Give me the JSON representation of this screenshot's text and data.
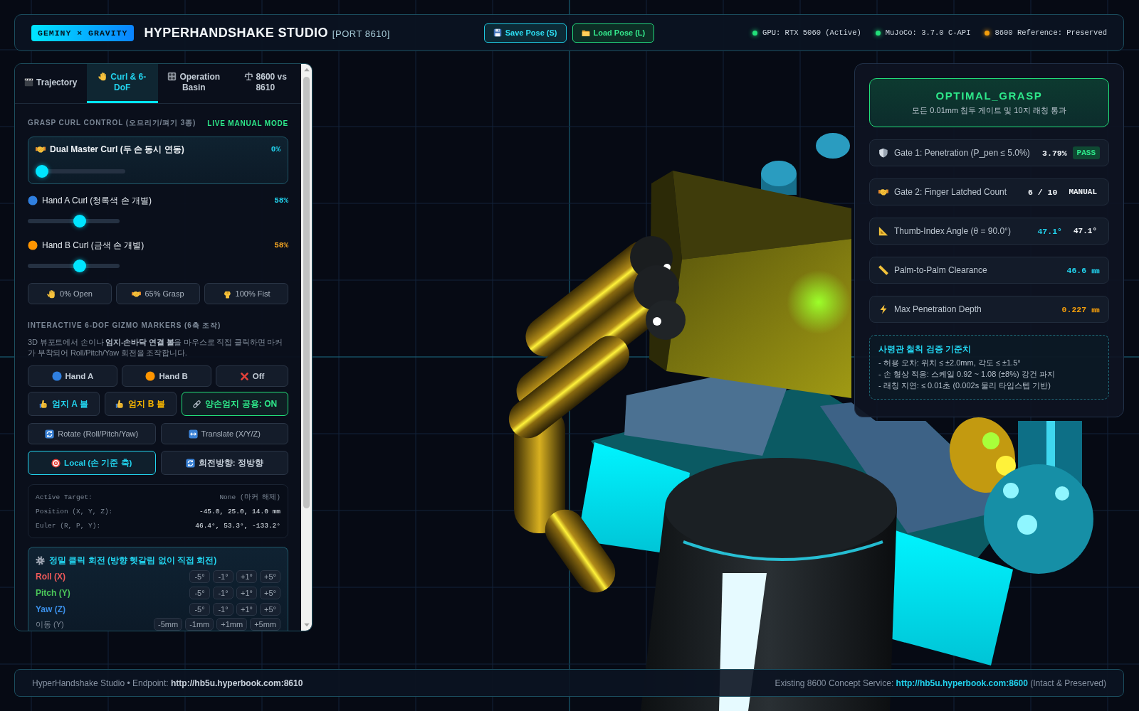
{
  "header": {
    "brand": "GEMINY × GRAVITY",
    "title": "HYPERHANDSHAKE STUDIO",
    "port": "[PORT 8610]",
    "buttons": [
      {
        "label": "Save Pose (S)",
        "kind": "save"
      },
      {
        "label": "Load Pose (L)",
        "kind": "load"
      }
    ],
    "status": [
      {
        "label": "GPU: RTX 5060 (Active)",
        "color": "#22e07a"
      },
      {
        "label": "MuJoCo: 3.7.0 C-API",
        "color": "#22e07a"
      },
      {
        "label": "8600 Reference: Preserved",
        "color": "#f59e0b"
      }
    ]
  },
  "left_panel": {
    "tabs": [
      {
        "label": "Trajectory",
        "selected": false
      },
      {
        "label": "Curl & 6-DoF",
        "selected": true
      },
      {
        "label": "Operation Basin",
        "selected": false
      },
      {
        "label": "8600 vs 8610",
        "selected": false
      }
    ],
    "curl": {
      "title": "GRASP CURL CONTROL (오므리기/펴기 3종)",
      "mode": "LIVE MANUAL MODE",
      "master": {
        "label": "Dual Master Curl (두 손 동시 연동)",
        "reading": "0%",
        "level": 0
      },
      "hands": [
        {
          "label": "Hand A Curl (청록색 손 개별)",
          "reading": "58%",
          "level": 0.58,
          "color": "#22d3ee"
        },
        {
          "label": "Hand B Curl (금색 손 개별)",
          "reading": "58%",
          "level": 0.58,
          "color": "#f5a623"
        }
      ],
      "presets": [
        "0% Open",
        "65% Grasp",
        "100% Fist"
      ]
    },
    "gizmo": {
      "title": "INTERACTIVE 6-DOF GIZMO MARKERS (6축 조작)",
      "description": "3D 뷰포트에서 손이나 **엄지-손바닥 연결 볼**을 마우스로 직접 클릭하면 마커가 부착되어 Roll/Pitch/Yaw 회전을 조작합니다.",
      "targets": [
        {
          "label": "Hand A",
          "selected": false
        },
        {
          "label": "Hand B",
          "selected": false
        },
        {
          "label": "Off",
          "selected": false
        }
      ],
      "thumb_balls": [
        {
          "label": "엄지 A 볼",
          "color": "#22d3ee"
        },
        {
          "label": "엄지 B 볼",
          "color": "#f5b400"
        }
      ],
      "shared_thumb": {
        "label": "양손엄지 공용: ON",
        "on": true
      },
      "modes": [
        {
          "label": "Rotate (Roll/Pitch/Yaw)",
          "selected": false
        },
        {
          "label": "Translate (X/Y/Z)",
          "selected": false
        }
      ],
      "options": [
        {
          "label": "Local (손 기준 축)",
          "on": true
        },
        {
          "label": "회전방향: 정방향",
          "on": false
        }
      ],
      "readout": [
        {
          "label": "Active Target:",
          "value": "None (마커 해제)",
          "muted": true
        },
        {
          "label": "Position (X, Y, Z):",
          "value": "-45.0, 25.0, 14.0 mm",
          "muted": false
        },
        {
          "label": "Euler (R, P, Y):",
          "value": "46.4°, 53.3°, -133.2°",
          "muted": false
        }
      ],
      "precision": {
        "title": "정밀 클릭 회전 (방향 헷갈림 없이 직접 회전)",
        "axes": [
          {
            "label": "Roll (X)",
            "color": "#f05a5a",
            "steps": [
              "-5°",
              "-1°",
              "+1°",
              "+5°"
            ]
          },
          {
            "label": "Pitch (Y)",
            "color": "#4cc85a",
            "steps": [
              "-5°",
              "-1°",
              "+1°",
              "+5°"
            ]
          },
          {
            "label": "Yaw (Z)",
            "color": "#3b8fe8",
            "steps": [
              "-5°",
              "-1°",
              "+1°",
              "+5°"
            ]
          }
        ],
        "translate": {
          "label": "이동 (Y)",
          "steps": [
            "-5mm",
            "-1mm",
            "+1mm",
            "+5mm"
          ]
        }
      }
    }
  },
  "right_panel": {
    "status": {
      "title": "OPTIMAL_GRASP",
      "subtitle": "모든 0.01mm 침투 게이트 및 10지 래칭 통과"
    },
    "metrics": [
      {
        "label": "Gate 1: Penetration (P_pen ≤ 5.0%)",
        "value": "3.79%",
        "color": "#f1f5f9",
        "badge": {
          "text": "PASS",
          "kind": "pass"
        }
      },
      {
        "label": "Gate 2: Finger Latched Count",
        "value": "6 / 10",
        "color": "#f1f5f9",
        "badge": {
          "text": "MANUAL",
          "kind": "plain"
        }
      },
      {
        "label": "Thumb-Index Angle (θ = 90.0°)",
        "value": "47.1°",
        "color": "#22d3ee",
        "badge": {
          "text": "47.1°",
          "kind": "plain"
        }
      },
      {
        "label": "Palm-to-Palm Clearance",
        "value": "46.6 ㎜",
        "color": "#22d3ee"
      },
      {
        "label": "Max Penetration Depth",
        "value": "0.227 ㎜",
        "color": "#f59e0b"
      }
    ],
    "criteria": {
      "title": "사령관 철칙 검증 기준치",
      "lines": [
        "- 허용 오차: 위치 ≤ ±2.0mm, 각도 ≤ ±1.5°",
        "- 손 형상 적응: 스케일 0.92 ~ 1.08 (±8%) 강건 파지",
        "- 래칭 지연: ≤ 0.01초 (0.002s 물리 타임스텝 기반)"
      ]
    }
  },
  "footer": {
    "endpoint": "HyperHandshake Studio • Endpoint: **http://hb5u.hyperbook.com:8610**",
    "service": {
      "text": "Existing 8600 Concept Service:",
      "link": "http://hb5u.hyperbook.com:8600",
      "note": "(Intact & Preserved)"
    }
  }
}
